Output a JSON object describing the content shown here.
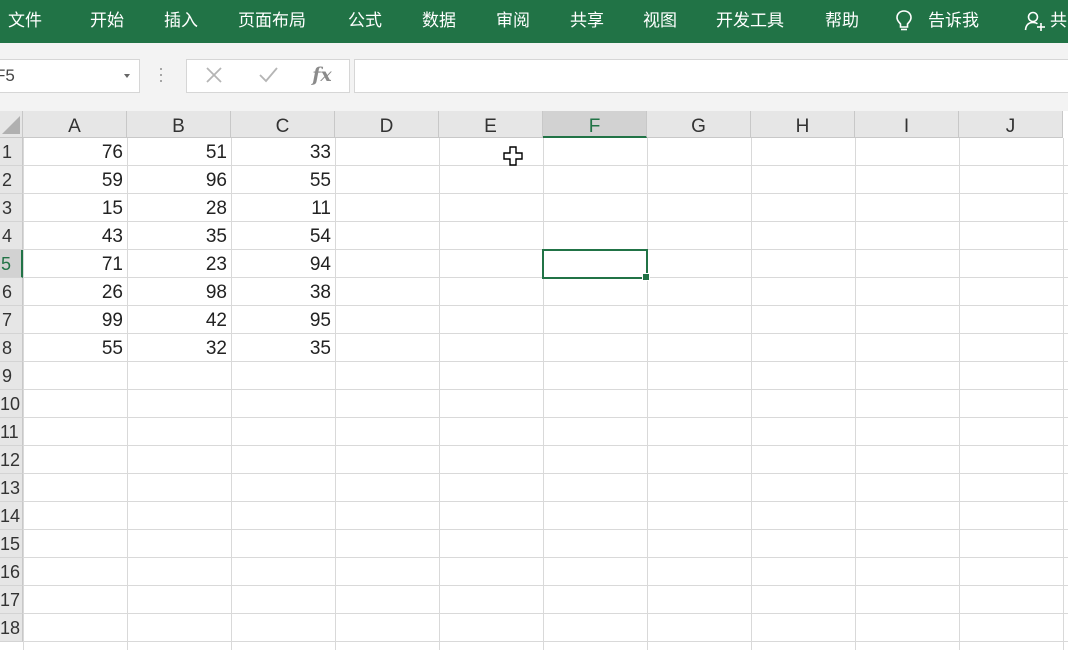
{
  "ribbon": {
    "tabs": [
      "文件",
      "开始",
      "插入",
      "页面布局",
      "公式",
      "数据",
      "审阅",
      "共享",
      "视图",
      "开发工具",
      "帮助"
    ],
    "tell_me": "告诉我",
    "share": "共"
  },
  "formula_bar": {
    "name_box": "F5",
    "fx_label": "fx",
    "formula": ""
  },
  "sheet": {
    "columns": [
      "A",
      "B",
      "C",
      "D",
      "E",
      "F",
      "G",
      "H",
      "I",
      "J"
    ],
    "rows": [
      "1",
      "2",
      "3",
      "4",
      "5",
      "6",
      "7",
      "8",
      "9",
      "10",
      "11",
      "12",
      "13",
      "14",
      "15",
      "16",
      "17",
      "18"
    ],
    "selected_column": "F",
    "selected_row": "5",
    "data": [
      [
        "76",
        "51",
        "33"
      ],
      [
        "59",
        "96",
        "55"
      ],
      [
        "15",
        "28",
        "11"
      ],
      [
        "43",
        "35",
        "54"
      ],
      [
        "71",
        "23",
        "94"
      ],
      [
        "26",
        "98",
        "38"
      ],
      [
        "99",
        "42",
        "95"
      ],
      [
        "55",
        "32",
        "35"
      ]
    ]
  },
  "colors": {
    "accent": "#217346",
    "grid_line": "#d9d9d9",
    "header_bg": "#e6e6e6"
  },
  "icons": {
    "tell_me": "lightbulb-icon",
    "share": "person-add-icon",
    "cancel": "close-icon",
    "enter": "check-icon",
    "cursor": "cell-select-cross-icon"
  }
}
